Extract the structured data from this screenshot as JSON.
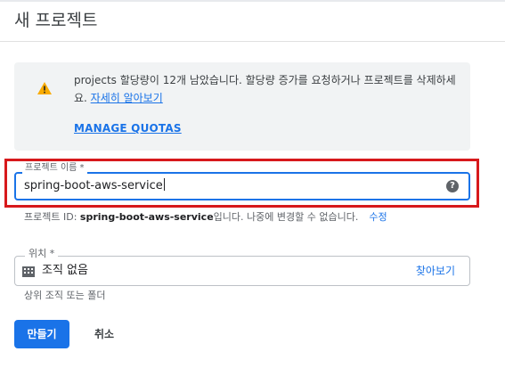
{
  "page": {
    "title": "새 프로젝트"
  },
  "quota_notice": {
    "icon": "warning-icon",
    "text": "projects 할당량이 12개 남았습니다. 할당량 증가를 요청하거나 프로젝트를 삭제하세요. ",
    "link_label": "자세히 알아보기",
    "action_label": "MANAGE QUOTAS"
  },
  "project_name": {
    "label": "프로젝트 이름 *",
    "value": "spring-boot-aws-service",
    "help_icon": "help-icon"
  },
  "project_id": {
    "prefix": "프로젝트 ID: ",
    "value": "spring-boot-aws-service",
    "suffix": "입니다. 나중에 변경할 수 없습니다.",
    "edit_label": "수정"
  },
  "location": {
    "label": "위치 *",
    "icon": "building-icon",
    "value": "조직 없음",
    "browse_label": "찾아보기",
    "hint": "상위 조직 또는 폴더"
  },
  "actions": {
    "create_label": "만들기",
    "cancel_label": "취소"
  },
  "colors": {
    "accent": "#1a73e8",
    "highlight": "#d7191c",
    "warning": "#f9ab00",
    "notice_bg": "#f1f3f4"
  }
}
